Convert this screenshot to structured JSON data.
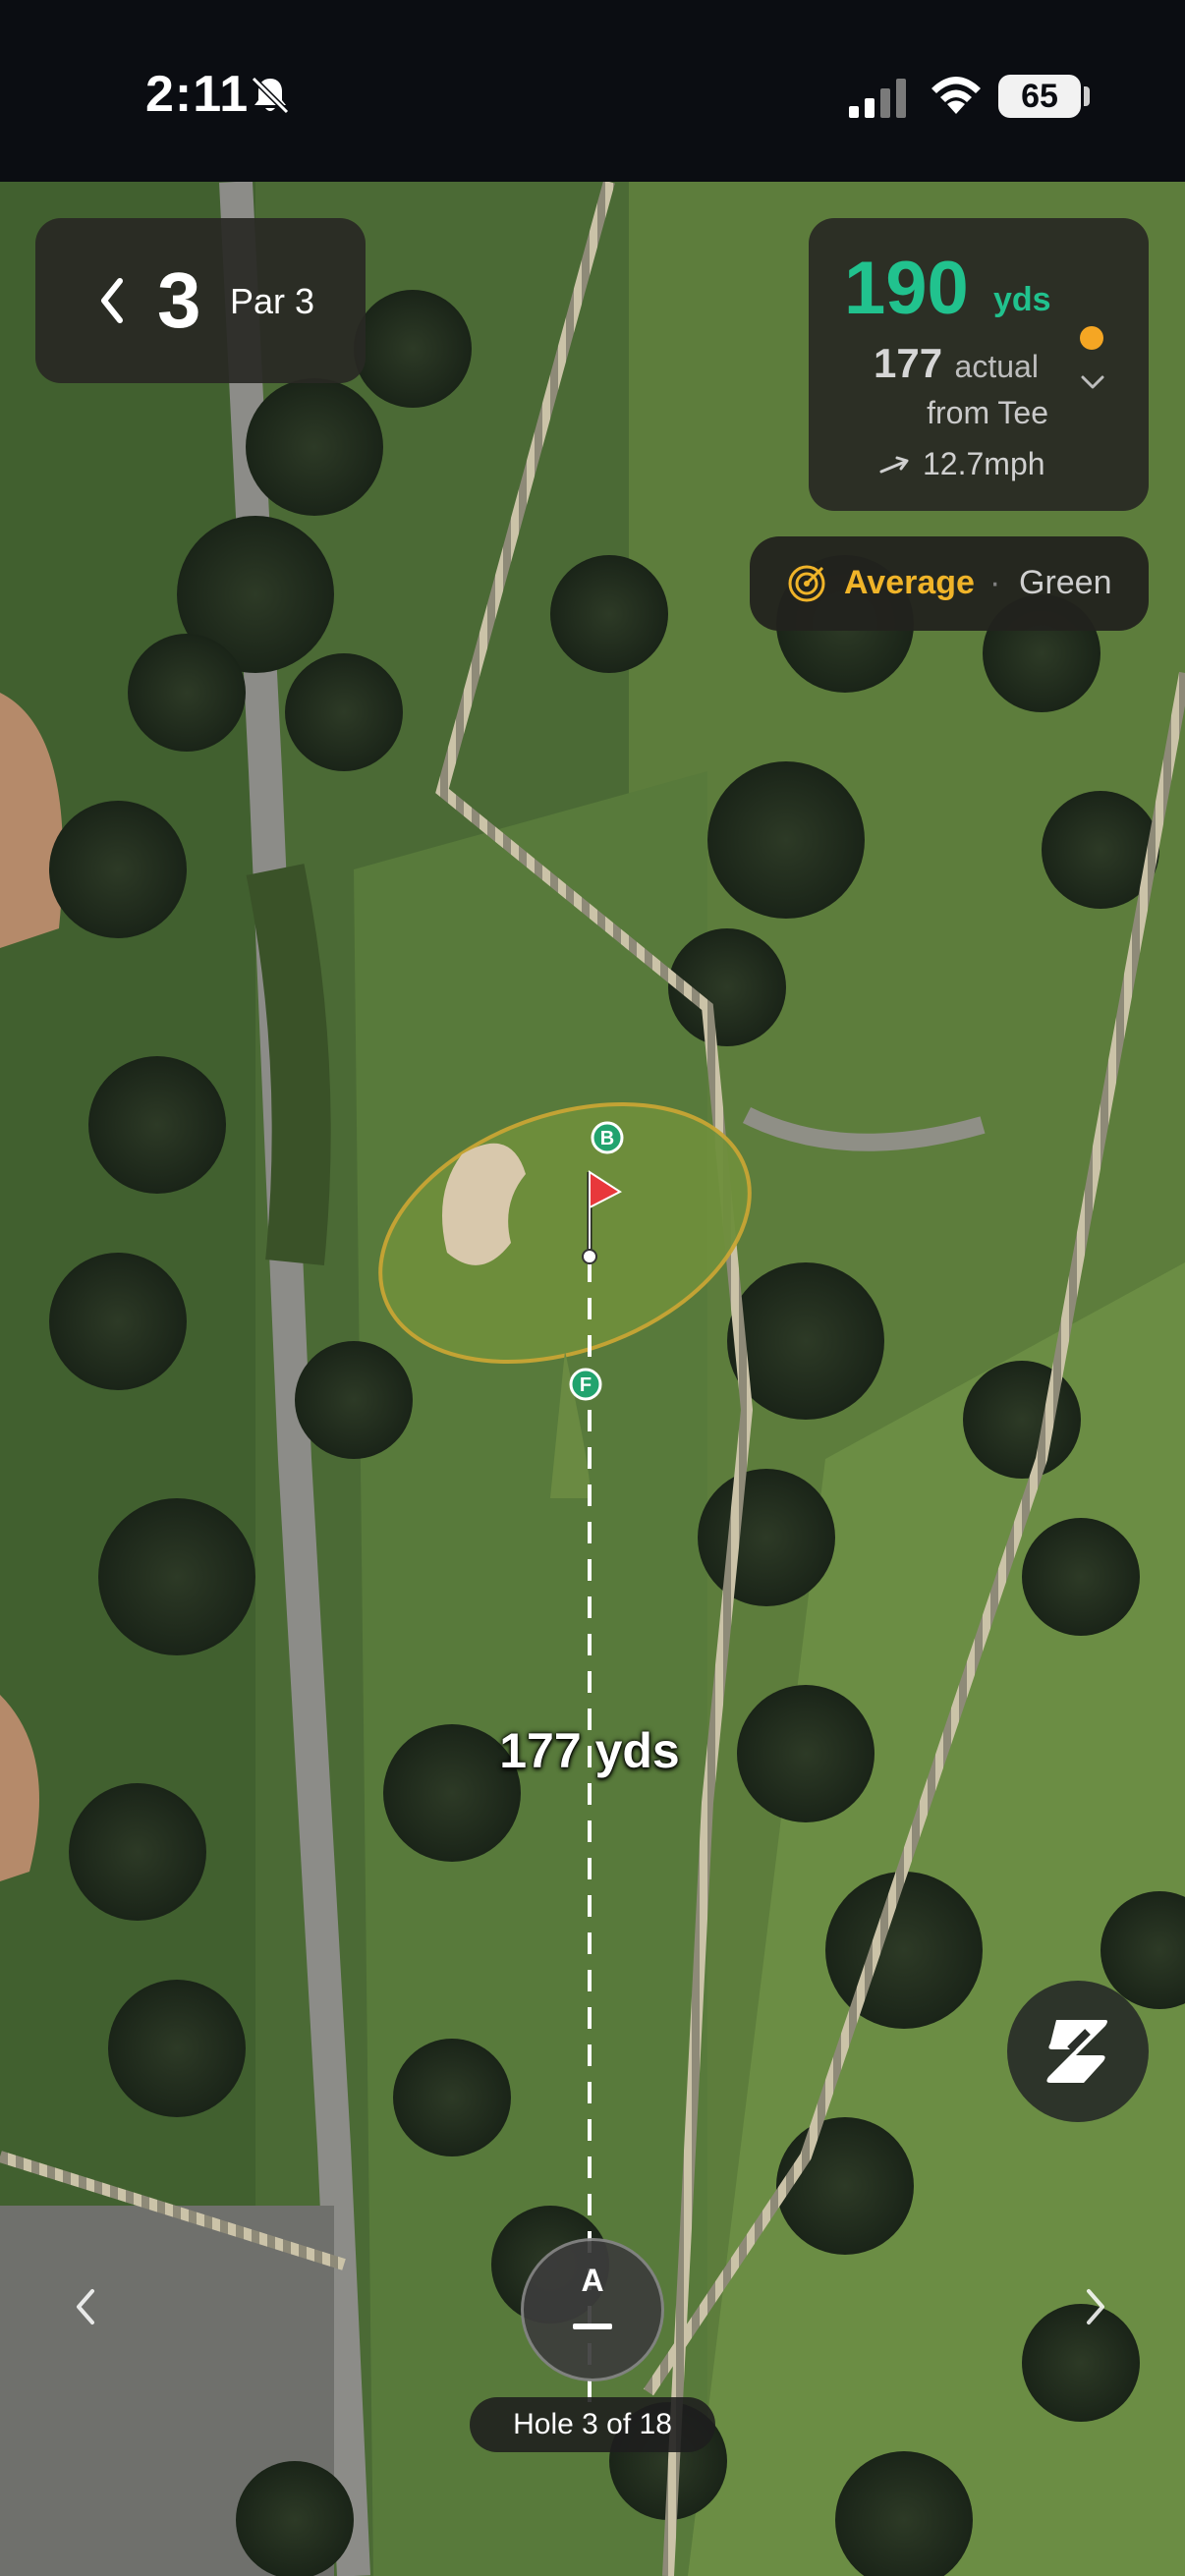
{
  "status_bar": {
    "time": "2:11",
    "battery": "65",
    "icons": [
      "bell-slash-icon",
      "cellular-signal-icon",
      "wifi-icon",
      "battery-icon"
    ]
  },
  "hole_card": {
    "hole_number": "3",
    "par_label": "Par 3"
  },
  "distance_card": {
    "distance": "190",
    "distance_unit": "yds",
    "actual_value": "177",
    "actual_label": "actual",
    "from_label": "from Tee",
    "wind": "12.7mph",
    "indicator_color": "#f5a623"
  },
  "mode_selector": {
    "selected": "Average",
    "separator": "·",
    "other": "Green"
  },
  "map": {
    "marker_back": "B",
    "marker_front": "F",
    "shot_distance": "177 yds"
  },
  "club_button": {
    "letter": "A"
  },
  "hole_indicator": "Hole 3 of 18",
  "colors": {
    "accent_green": "#21c28e",
    "accent_gold": "#f0b429",
    "flag_red": "#e8383b"
  }
}
